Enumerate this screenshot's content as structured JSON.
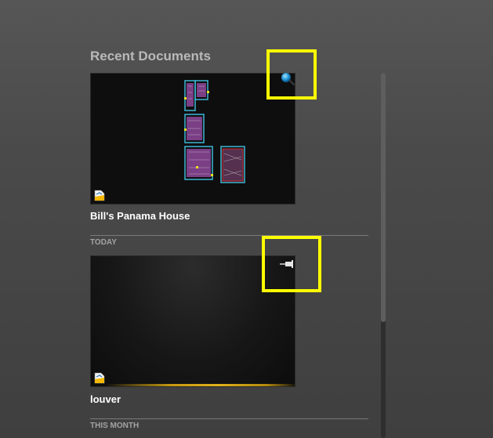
{
  "panel": {
    "title": "Recent Documents"
  },
  "documents": [
    {
      "title": "Bill's Panama House",
      "icon": "drawing-file-icon",
      "corner_icon": "globe-icon"
    },
    {
      "title": "louver",
      "icon": "drawing-file-icon",
      "corner_icon": "pin-icon"
    }
  ],
  "sections": [
    {
      "label": "TODAY"
    },
    {
      "label": "THIS MONTH"
    }
  ],
  "colors": {
    "highlight": "#ffff00",
    "accent_glow": "#e0b21a"
  }
}
